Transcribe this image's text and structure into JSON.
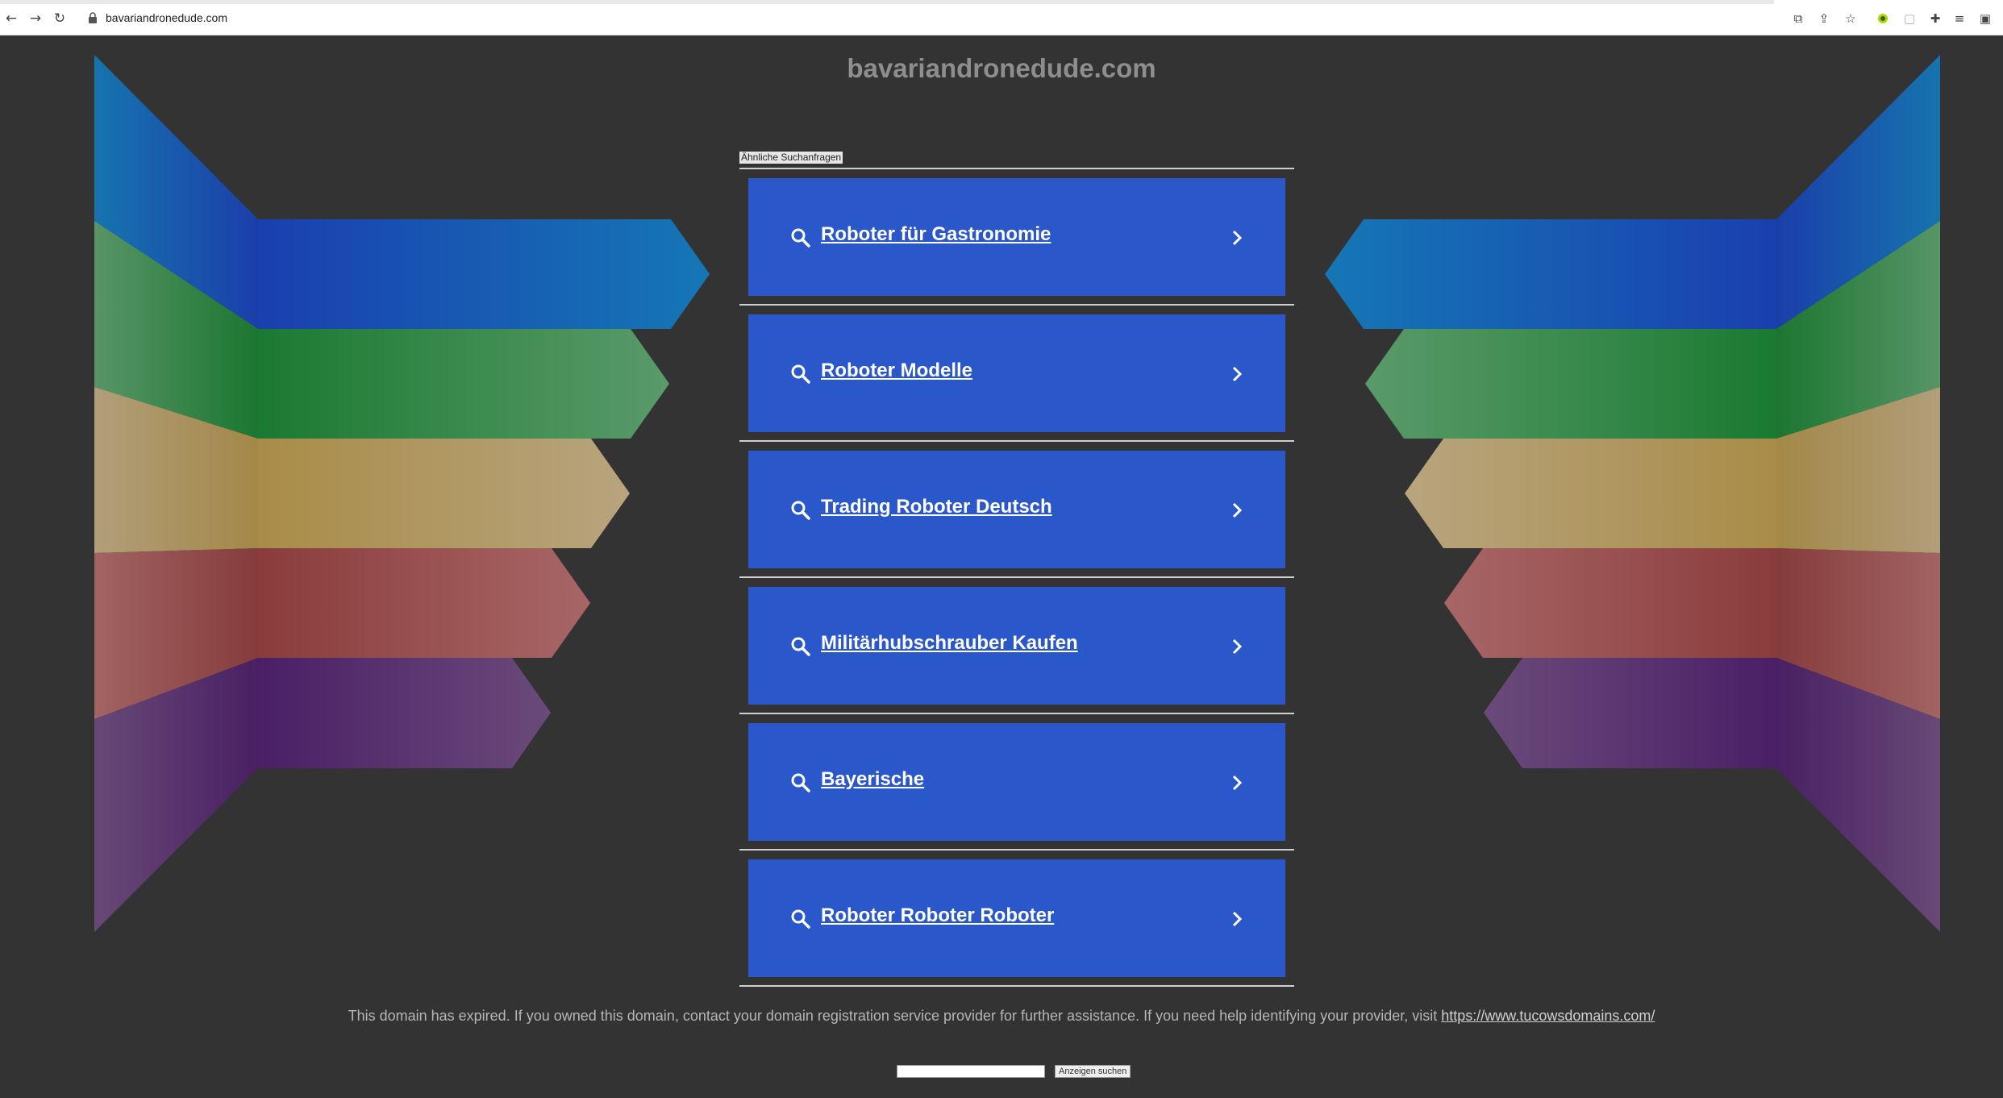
{
  "browser": {
    "url": "bavariandronedude.com",
    "icons": [
      "back-icon",
      "forward-icon",
      "reload-icon",
      "lock-icon",
      "translate-icon",
      "share-icon",
      "star-icon",
      "extension-icon",
      "copy-icon",
      "puzzle-icon",
      "reading-list-icon",
      "sidepanel-icon"
    ]
  },
  "page": {
    "site_title": "bavariandronedude.com",
    "related_label": "Ähnliche Suchanfragen",
    "links": [
      {
        "label": "Roboter für Gastronomie"
      },
      {
        "label": "Roboter Modelle"
      },
      {
        "label": "Trading Roboter Deutsch"
      },
      {
        "label": "Militärhubschrauber Kaufen"
      },
      {
        "label": "Bayerische"
      },
      {
        "label": "Roboter Roboter Roboter"
      }
    ],
    "notice_text": "This domain has expired. If you owned this domain, contact your domain registration service provider for further assistance. If you need help identifying your provider, visit ",
    "notice_link": "https://www.tucowsdomains.com/",
    "search_button": "Anzeigen suchen",
    "search_value": ""
  },
  "colors": {
    "background": "#333333",
    "card": "#2a57c9",
    "stripes": [
      "#1a66b8",
      "#2e8a3c",
      "#b59a5a",
      "#9b4a4a",
      "#5a2a7a"
    ]
  }
}
